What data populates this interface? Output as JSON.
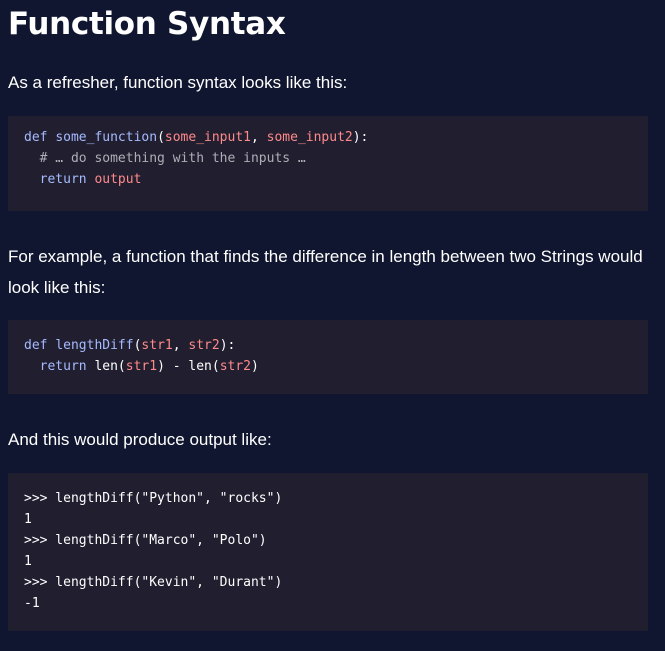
{
  "title": "Function Syntax",
  "intro": "As a refresher, function syntax looks like this:",
  "syntax_code": {
    "l1": {
      "kw": "def",
      "name": "some_function",
      "open": "(",
      "a1": "some_input1",
      "sep": ", ",
      "a2": "some_input2",
      "close": "):"
    },
    "l2": {
      "comment": "# … do something with the inputs …"
    },
    "l3": {
      "kw": "return",
      "val": "output"
    }
  },
  "example_text": "For example, a function that finds the difference in length between two Strings would look like this:",
  "example_code": {
    "l1": {
      "kw": "def",
      "name": "lengthDiff",
      "open": "(",
      "a1": "str1",
      "sep": ", ",
      "a2": "str2",
      "close": "):"
    },
    "l2": {
      "kw": "return",
      "len1": "len(",
      "a1": "str1",
      "mid": ") - len(",
      "a2": "str2",
      "end": ")"
    }
  },
  "output_text": "And this would produce output like:",
  "output_code": [
    ">>> lengthDiff(\"Python\", \"rocks\")",
    "1",
    ">>> lengthDiff(\"Marco\", \"Polo\")",
    "1",
    ">>> lengthDiff(\"Kevin\", \"Durant\")",
    "-1"
  ]
}
